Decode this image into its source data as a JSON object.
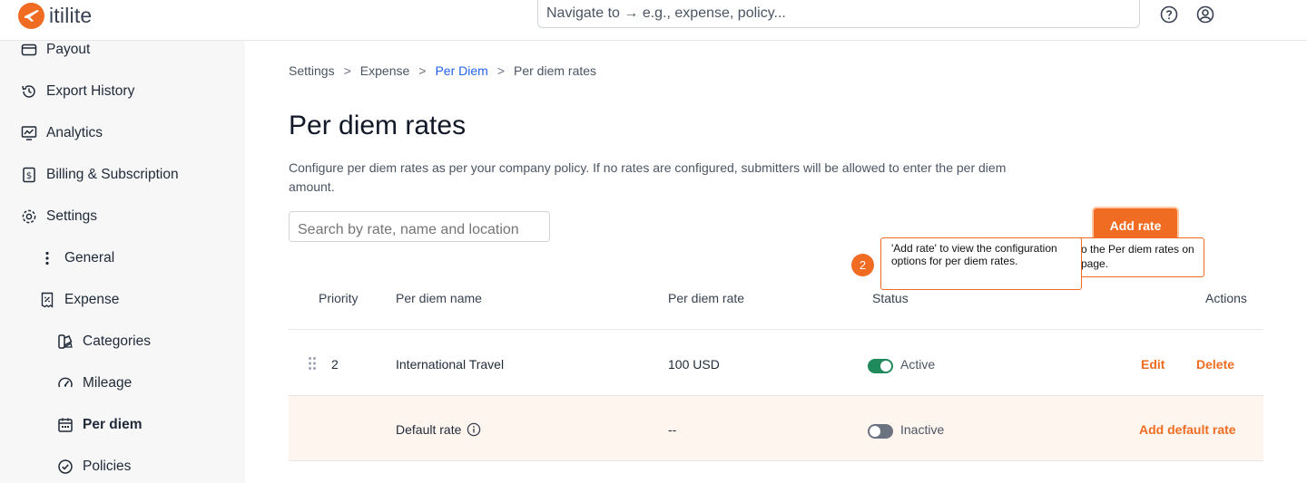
{
  "app": {
    "logo_text": "itilite",
    "global_search_placeholder": "Navigate to → e.g., expense, policy..."
  },
  "sidebar": {
    "items": [
      {
        "label": "Payout",
        "icon": "wallet-icon"
      },
      {
        "label": "Export History",
        "icon": "history-icon"
      },
      {
        "label": "Analytics",
        "icon": "analytics-icon"
      },
      {
        "label": "Billing & Subscription",
        "icon": "billing-icon"
      },
      {
        "label": "Settings",
        "icon": "gear-icon"
      },
      {
        "label": "General",
        "icon": "more-vertical-icon"
      },
      {
        "label": "Expense",
        "icon": "receipt-icon"
      },
      {
        "label": "Categories",
        "icon": "categories-icon"
      },
      {
        "label": "Mileage",
        "icon": "speedometer-icon"
      },
      {
        "label": "Per diem",
        "icon": "calendar-icon"
      },
      {
        "label": "Policies",
        "icon": "check-circle-icon"
      }
    ]
  },
  "breadcrumb": {
    "items": [
      "Settings",
      "Expense",
      "Per Diem",
      "Per diem rates"
    ],
    "separator": ">"
  },
  "page": {
    "title": "Per diem rates",
    "description": "Configure per diem rates as per your company policy. If no rates are configured, submitters will be allowed to enter the per diem amount.",
    "search_placeholder": "Search by rate, name and location",
    "add_rate_label": "Add rate"
  },
  "tooltip": {
    "step": "2",
    "main_text": "'Add rate' to view the configuration options for per diem rates.",
    "back_text": "o the Per diem rates on page."
  },
  "table": {
    "headers": {
      "priority": "Priority",
      "name": "Per diem name",
      "rate": "Per diem rate",
      "status": "Status",
      "actions": "Actions"
    },
    "rows": [
      {
        "priority": "2",
        "name": "International Travel",
        "rate": "100 USD",
        "status": "Active",
        "edit": "Edit",
        "delete": "Delete"
      },
      {
        "priority": "",
        "name": "Default rate",
        "rate": "--",
        "status": "Inactive",
        "action": "Add default rate"
      }
    ]
  },
  "colors": {
    "accent": "#ef6c22",
    "toggle_active": "#1f8a5b",
    "toggle_inactive": "#6b7280",
    "link": "#2563eb"
  }
}
